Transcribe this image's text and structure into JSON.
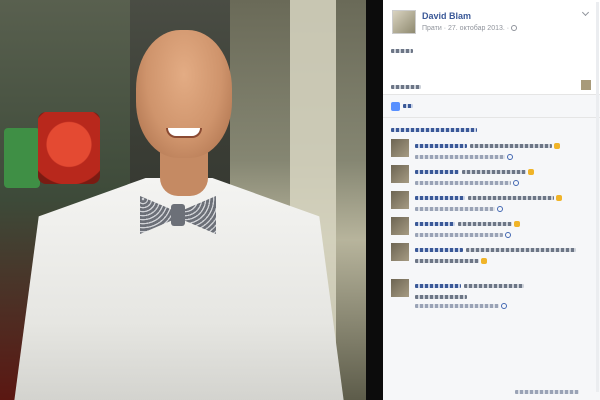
{
  "post": {
    "author": "David Blam",
    "meta_text": "Прати · 27. октобар 2013. ·"
  },
  "icons": {
    "privacy": "globe-icon",
    "options": "chevron-down-icon",
    "like": "like-icon",
    "emoji": "emoji-icon",
    "reaction": "reaction-icon"
  },
  "colors": {
    "link_blue": "#3b5998",
    "meta_gray": "#90949c",
    "feedback_bg": "#f6f7f9",
    "like_blue": "#5890ff"
  }
}
